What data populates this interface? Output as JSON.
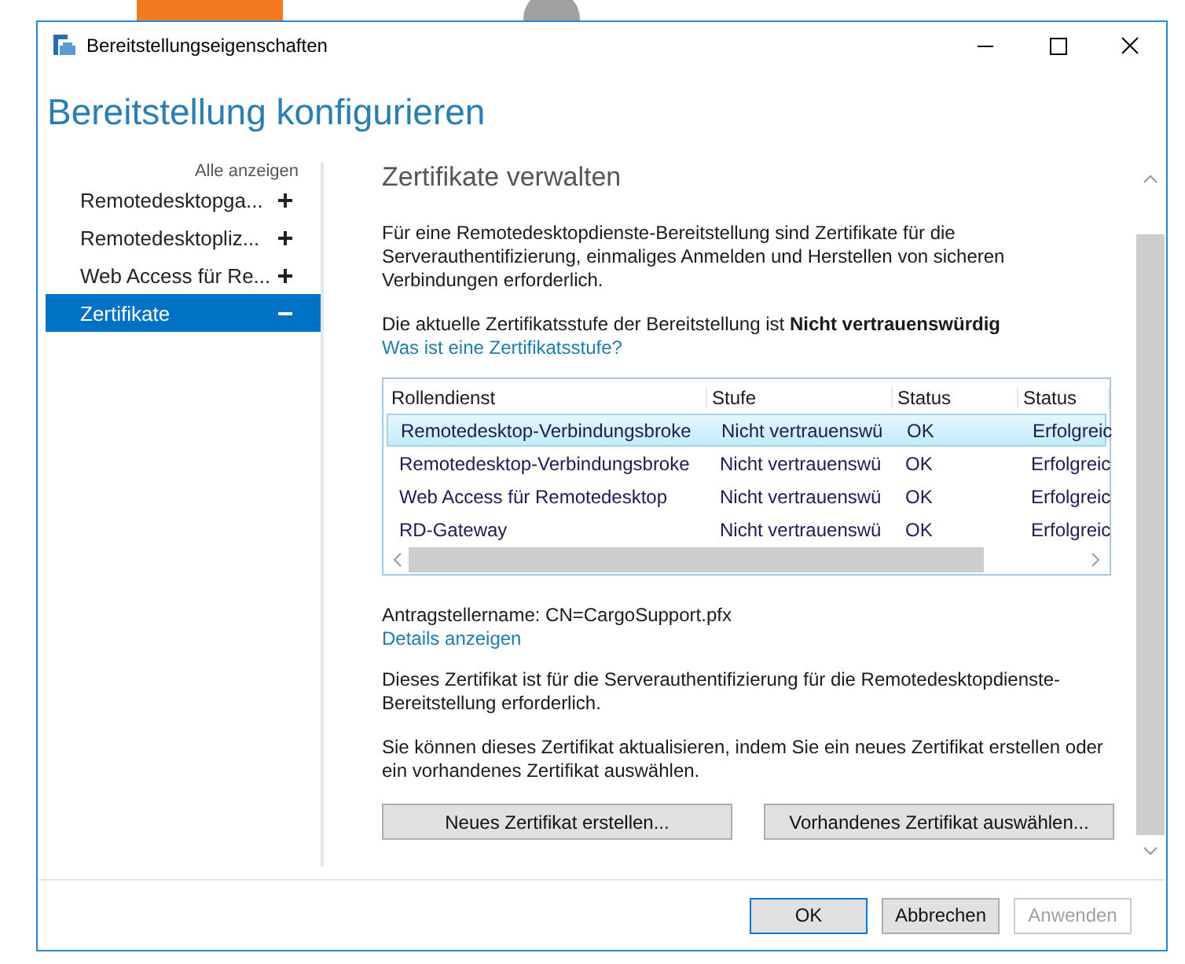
{
  "window": {
    "title": "Bereitstellungseigenschaften"
  },
  "header": "Bereitstellung konfigurieren",
  "sidebar": {
    "show_all": "Alle anzeigen",
    "items": [
      {
        "label": "Remotedesktopga...",
        "expanded": false,
        "selected": false
      },
      {
        "label": "Remotedesktopliz...",
        "expanded": false,
        "selected": false
      },
      {
        "label": "Web Access für Re...",
        "expanded": false,
        "selected": false
      },
      {
        "label": "Zertifikate",
        "expanded": true,
        "selected": true
      }
    ]
  },
  "content": {
    "heading": "Zertifikate verwalten",
    "intro": "Für eine Remotedesktopdienste-Bereitstellung sind Zertifikate für die Serverauthentifizierung, einmaliges Anmelden und Herstellen von sicheren Verbindungen erforderlich.",
    "level_text": "Die aktuelle Zertifikatsstufe der Bereitstellung ist **Nicht vertrauenswürdig**",
    "level_link": "Was ist eine Zertifikatsstufe?",
    "table": {
      "columns": [
        "Rollendienst",
        "Stufe",
        "Status",
        "Status"
      ],
      "rows": [
        {
          "selected": true,
          "cells": [
            "Remotedesktop-Verbindungsbroke",
            "Nicht vertrauenswü",
            "OK",
            "Erfolgreic"
          ]
        },
        {
          "selected": false,
          "cells": [
            "Remotedesktop-Verbindungsbroke",
            "Nicht vertrauenswü",
            "OK",
            "Erfolgreic"
          ]
        },
        {
          "selected": false,
          "cells": [
            "Web Access für Remotedesktop",
            "Nicht vertrauenswü",
            "OK",
            "Erfolgreic"
          ]
        },
        {
          "selected": false,
          "cells": [
            "RD-Gateway",
            "Nicht vertrauenswü",
            "OK",
            "Erfolgreic"
          ]
        }
      ]
    },
    "subject": "Antragstellername: CN=CargoSupport.pfx",
    "details_link": "Details anzeigen",
    "note1": "Dieses Zertifikat ist für die Serverauthentifizierung für die Remotedesktopdienste-Bereitstellung erforderlich.",
    "note2": "Sie können dieses Zertifikat aktualisieren, indem Sie ein neues Zertifikat erstellen oder ein vorhandenes Zertifikat auswählen.",
    "actions": [
      "Neues Zertifikat erstellen...",
      "Vorhandenes Zertifikat auswählen..."
    ]
  },
  "buttons": [
    {
      "label": "OK",
      "disabled": false,
      "default": true
    },
    {
      "label": "Abbrechen",
      "disabled": false,
      "default": false
    },
    {
      "label": "Anwenden",
      "disabled": true,
      "default": false
    }
  ]
}
